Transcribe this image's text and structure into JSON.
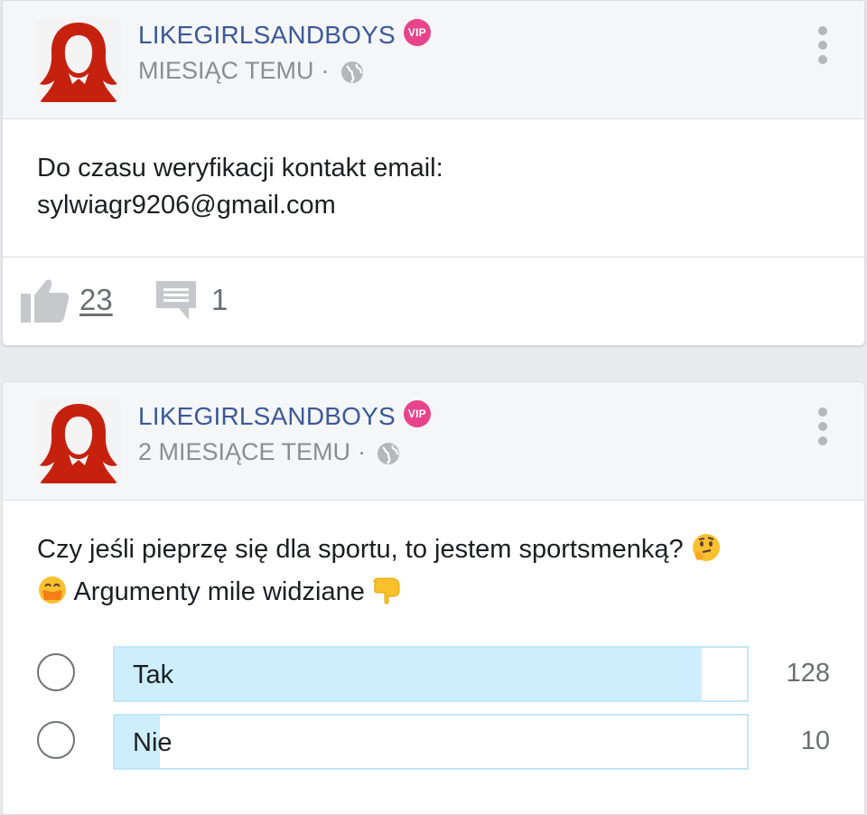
{
  "posts": [
    {
      "author": "LIKEGIRLSANDBOYS",
      "badge": "VIP",
      "time": "MIESIĄC TEMU",
      "separator": "·",
      "privacy_icon": "globe-icon",
      "text_line1": "Do czasu weryfikacji kontakt email:",
      "text_line2": "sylwiagr9206@gmail.com",
      "likes": "23",
      "comments": "1"
    },
    {
      "author": "LIKEGIRLSANDBOYS",
      "badge": "VIP",
      "time": "2 MIESIĄCE TEMU",
      "separator": "·",
      "privacy_icon": "globe-icon",
      "text_line1": "Czy jeśli pieprzę się dla sportu, to jestem sportsmenką?",
      "text_line2": "Argumenty mile widziane",
      "poll": {
        "options": [
          {
            "label": "Tak",
            "votes": "128",
            "fraction": 0.928
          },
          {
            "label": "Nie",
            "votes": "10",
            "fraction": 0.072
          }
        ]
      }
    }
  ],
  "colors": {
    "author": "#3b5998",
    "vip_badge": "#e8448b",
    "poll_fill": "#cdeefc",
    "avatar_hair": "#c6210f"
  }
}
